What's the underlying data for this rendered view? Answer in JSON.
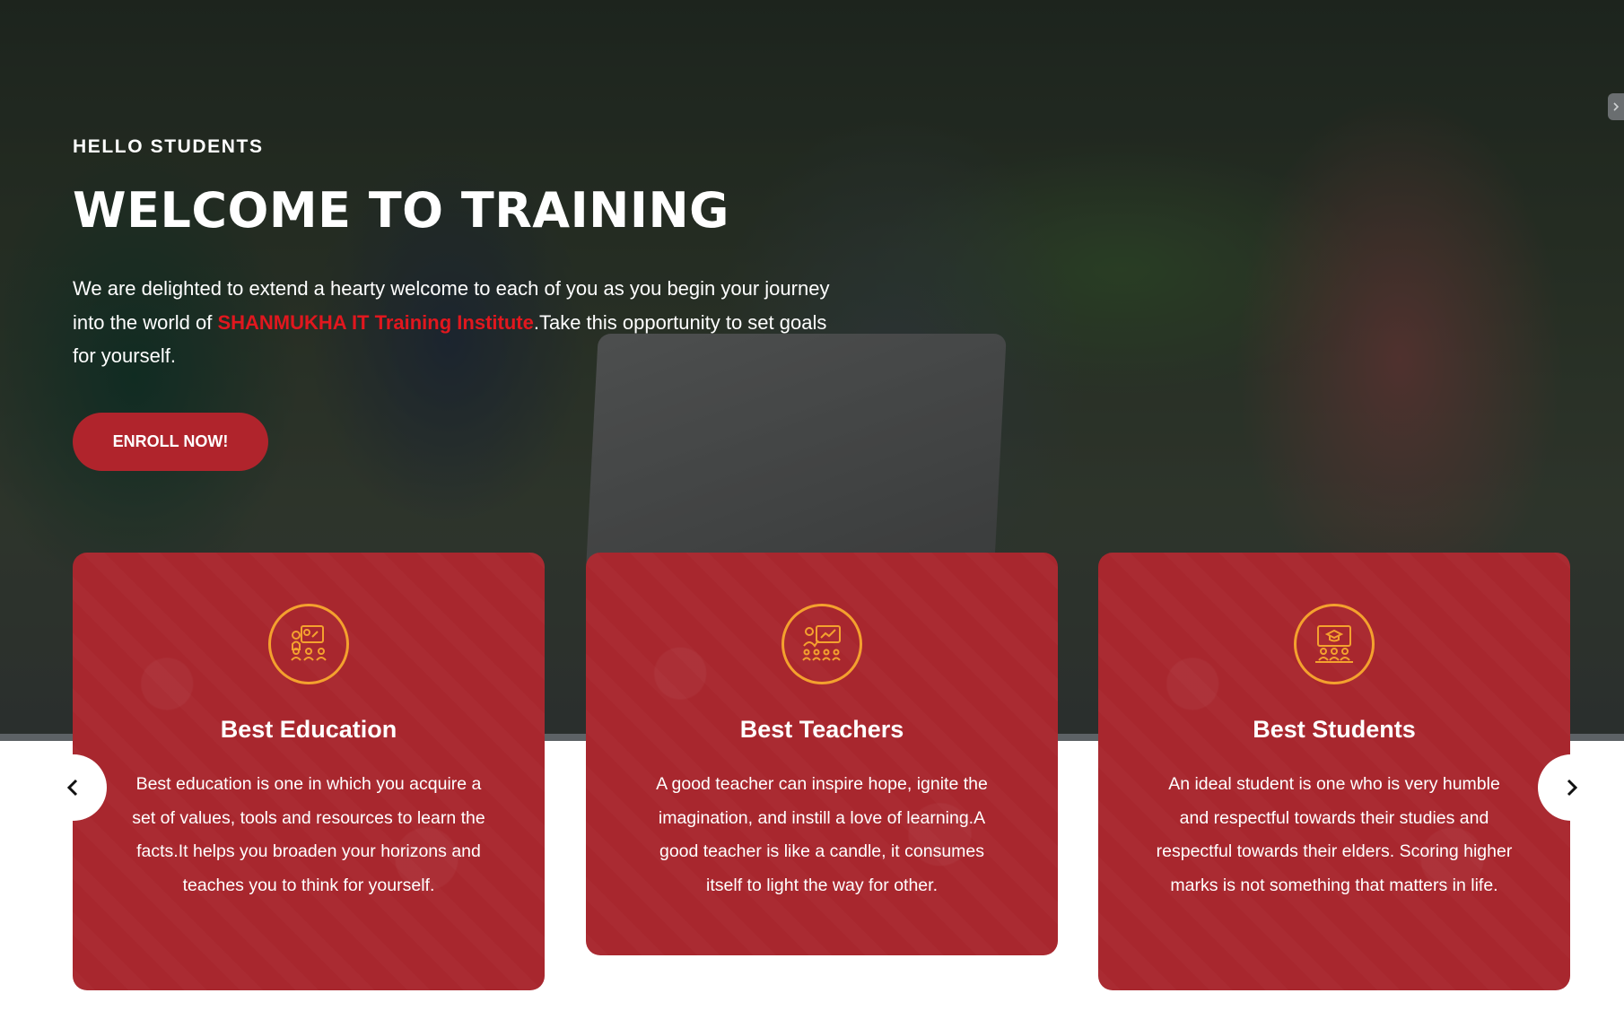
{
  "hero": {
    "tagline": "HELLO STUDENTS",
    "title": "WELCOME TO TRAINING",
    "description_before": "We are delighted to extend a hearty welcome to each of you as you begin your journey into the world of ",
    "description_highlight": "SHANMUKHA IT Training Institute",
    "description_after": ".Take this opportunity to set goals for yourself.",
    "enroll_label": "ENROLL NOW!"
  },
  "cards": [
    {
      "icon": "education-icon",
      "title": "Best Education",
      "text": "Best education is one in which you acquire a set of values, tools and resources to learn the facts.It helps you broaden your horizons and teaches you to think for yourself."
    },
    {
      "icon": "teacher-icon",
      "title": "Best Teachers",
      "text": "A good teacher can inspire hope, ignite the imagination, and instill a love of learning.A good teacher is like a candle, it consumes itself to light the way for other."
    },
    {
      "icon": "students-icon",
      "title": "Best Students",
      "text": "An ideal student is one who is very humble and respectful towards their studies and respectful towards their elders. Scoring higher marks is not something that matters in life."
    }
  ],
  "carousel": {
    "prev_icon": "chevron-left-icon",
    "next_icon": "chevron-right-icon"
  },
  "colors": {
    "brand_red": "#a8272e",
    "button_red": "#b0242c",
    "highlight_red": "#e1171e",
    "icon_orange": "#f4a12e"
  }
}
